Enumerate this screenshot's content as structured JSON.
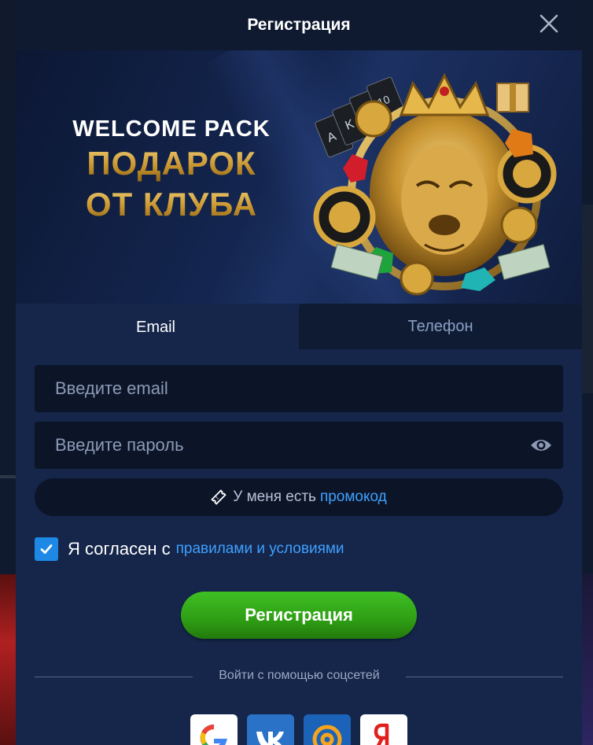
{
  "modal": {
    "title": "Регистрация"
  },
  "banner": {
    "line1": "WELCOME PACK",
    "line2": "ПОДАРОК",
    "line3": "ОТ КЛУБА"
  },
  "tabs": [
    {
      "label": "Email",
      "active": true
    },
    {
      "label": "Телефон",
      "active": false
    }
  ],
  "form": {
    "email_placeholder": "Введите email",
    "password_placeholder": "Введите пароль",
    "promo_prefix": "У меня есть",
    "promo_link": "промокод",
    "agree_prefix": "Я согласен с",
    "agree_link": "правилами и условиями",
    "agree_checked": true,
    "submit_label": "Регистрация",
    "social_divider": "Войти с помощью соцсетей"
  },
  "social": [
    "google-icon",
    "vk-icon",
    "mail-ru-icon",
    "yandex-icon"
  ],
  "colors": {
    "accent_link": "#3fa0ff",
    "submit_green": "#2e9e14",
    "modal_bg": "#15264a",
    "field_bg": "#0c1528"
  }
}
